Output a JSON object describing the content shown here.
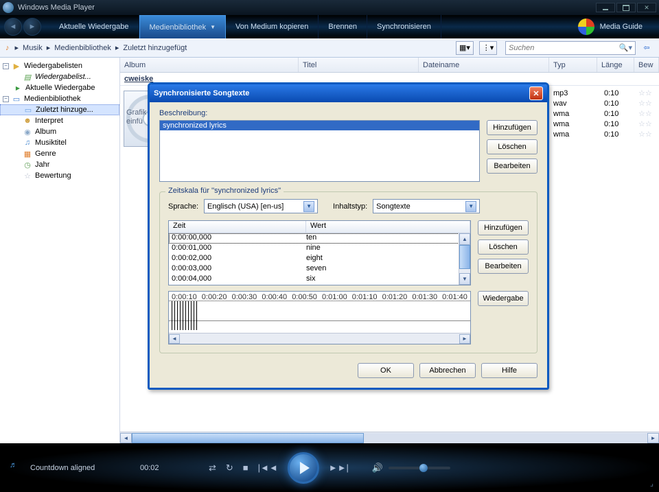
{
  "app": {
    "title": "Windows Media Player"
  },
  "nav": {
    "tab_current": "Aktuelle Wiedergabe",
    "tab_library": "Medienbibliothek",
    "tab_rip": "Von Medium kopieren",
    "tab_burn": "Brennen",
    "tab_sync": "Synchronisieren",
    "media_guide": "Media Guide"
  },
  "crumb": {
    "root": "Musik",
    "lib": "Medienbibliothek",
    "recent": "Zuletzt hinzugefügt"
  },
  "search": {
    "placeholder": "Suchen"
  },
  "sidebar": {
    "playlists": "Wiedergabelisten",
    "playlist_item": "Wiedergabelist...",
    "current": "Aktuelle Wiedergabe",
    "library": "Medienbibliothek",
    "recent": "Zuletzt hinzuge...",
    "artist": "Interpret",
    "album": "Album",
    "title": "Musiktitel",
    "genre": "Genre",
    "year": "Jahr",
    "rating": "Bewertung"
  },
  "columns": {
    "album": "Album",
    "title": "Titel",
    "filename": "Dateiname",
    "type": "Typ",
    "length": "Länge",
    "rating": "Bew"
  },
  "album_group": "cweiske",
  "album_art": {
    "line1": "Grafik",
    "line2": "einfü"
  },
  "rows": [
    {
      "type": "mp3",
      "length": "0:10"
    },
    {
      "type": "wav",
      "length": "0:10"
    },
    {
      "type": "wma",
      "length": "0:10"
    },
    {
      "type": "wma",
      "length": "0:10"
    },
    {
      "type": "wma",
      "length": "0:10"
    }
  ],
  "player": {
    "track": "Countdown aligned",
    "time": "00:02"
  },
  "dialog": {
    "title": "Synchronisierte Songtexte",
    "desc_label": "Beschreibung:",
    "desc_item": "synchronized lyrics",
    "btn_add": "Hinzufügen",
    "btn_delete": "Löschen",
    "btn_edit": "Bearbeiten",
    "btn_play": "Wiedergabe",
    "group_title": "Zeitskala für ''synchronized lyrics''",
    "lang_label": "Sprache:",
    "lang_value": "Englisch (USA) [en-us]",
    "type_label": "Inhaltstyp:",
    "type_value": "Songtexte",
    "col_time": "Zeit",
    "col_value": "Wert",
    "times": [
      {
        "t": "0:00:00,000",
        "v": "ten"
      },
      {
        "t": "0:00:01,000",
        "v": "nine"
      },
      {
        "t": "0:00:02,000",
        "v": "eight"
      },
      {
        "t": "0:00:03,000",
        "v": "seven"
      },
      {
        "t": "0:00:04,000",
        "v": "six"
      }
    ],
    "ticks": [
      "0:00:10",
      "0:00:20",
      "0:00:30",
      "0:00:40",
      "0:00:50",
      "0:01:00",
      "0:01:10",
      "0:01:20",
      "0:01:30",
      "0:01:40"
    ],
    "btn_ok": "OK",
    "btn_cancel": "Abbrechen",
    "btn_help": "Hilfe"
  }
}
